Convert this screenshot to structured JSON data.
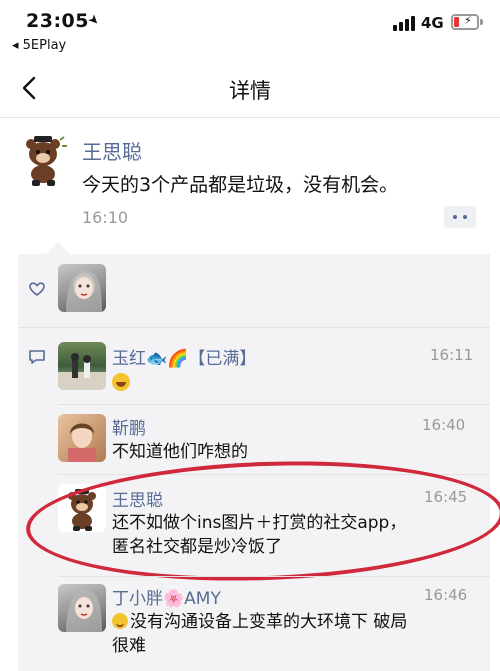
{
  "status_bar": {
    "time": "23:05",
    "back_app": "◂ 5EPlay",
    "network": "4G",
    "battery_color": "#e53935"
  },
  "nav": {
    "title": "详情",
    "back_icon": "chevron-left-icon"
  },
  "post": {
    "author": "王思聪",
    "text": "今天的3个产品都是垃圾，没有机会。",
    "time": "16:10"
  },
  "comments": [
    {
      "name": "玉红🐟🌈【已满】",
      "time": "16:11",
      "text": ""
    },
    {
      "name": "靳鹏",
      "time": "16:40",
      "text": "不知道他们咋想的"
    },
    {
      "name": "王思聪",
      "time": "16:45",
      "text": "还不如做个ins图片＋打赏的社交app，",
      "text2": "匿名社交都是炒冷饭了"
    },
    {
      "name": "丁小胖🌸AMY",
      "time": "16:46",
      "text": "没有沟通设备上变革的大环境下 破局",
      "text2": "很难"
    }
  ],
  "colors": {
    "link_blue": "#576b95",
    "highlight_red": "#d0293b",
    "panel_bg": "#f3f3f5"
  }
}
